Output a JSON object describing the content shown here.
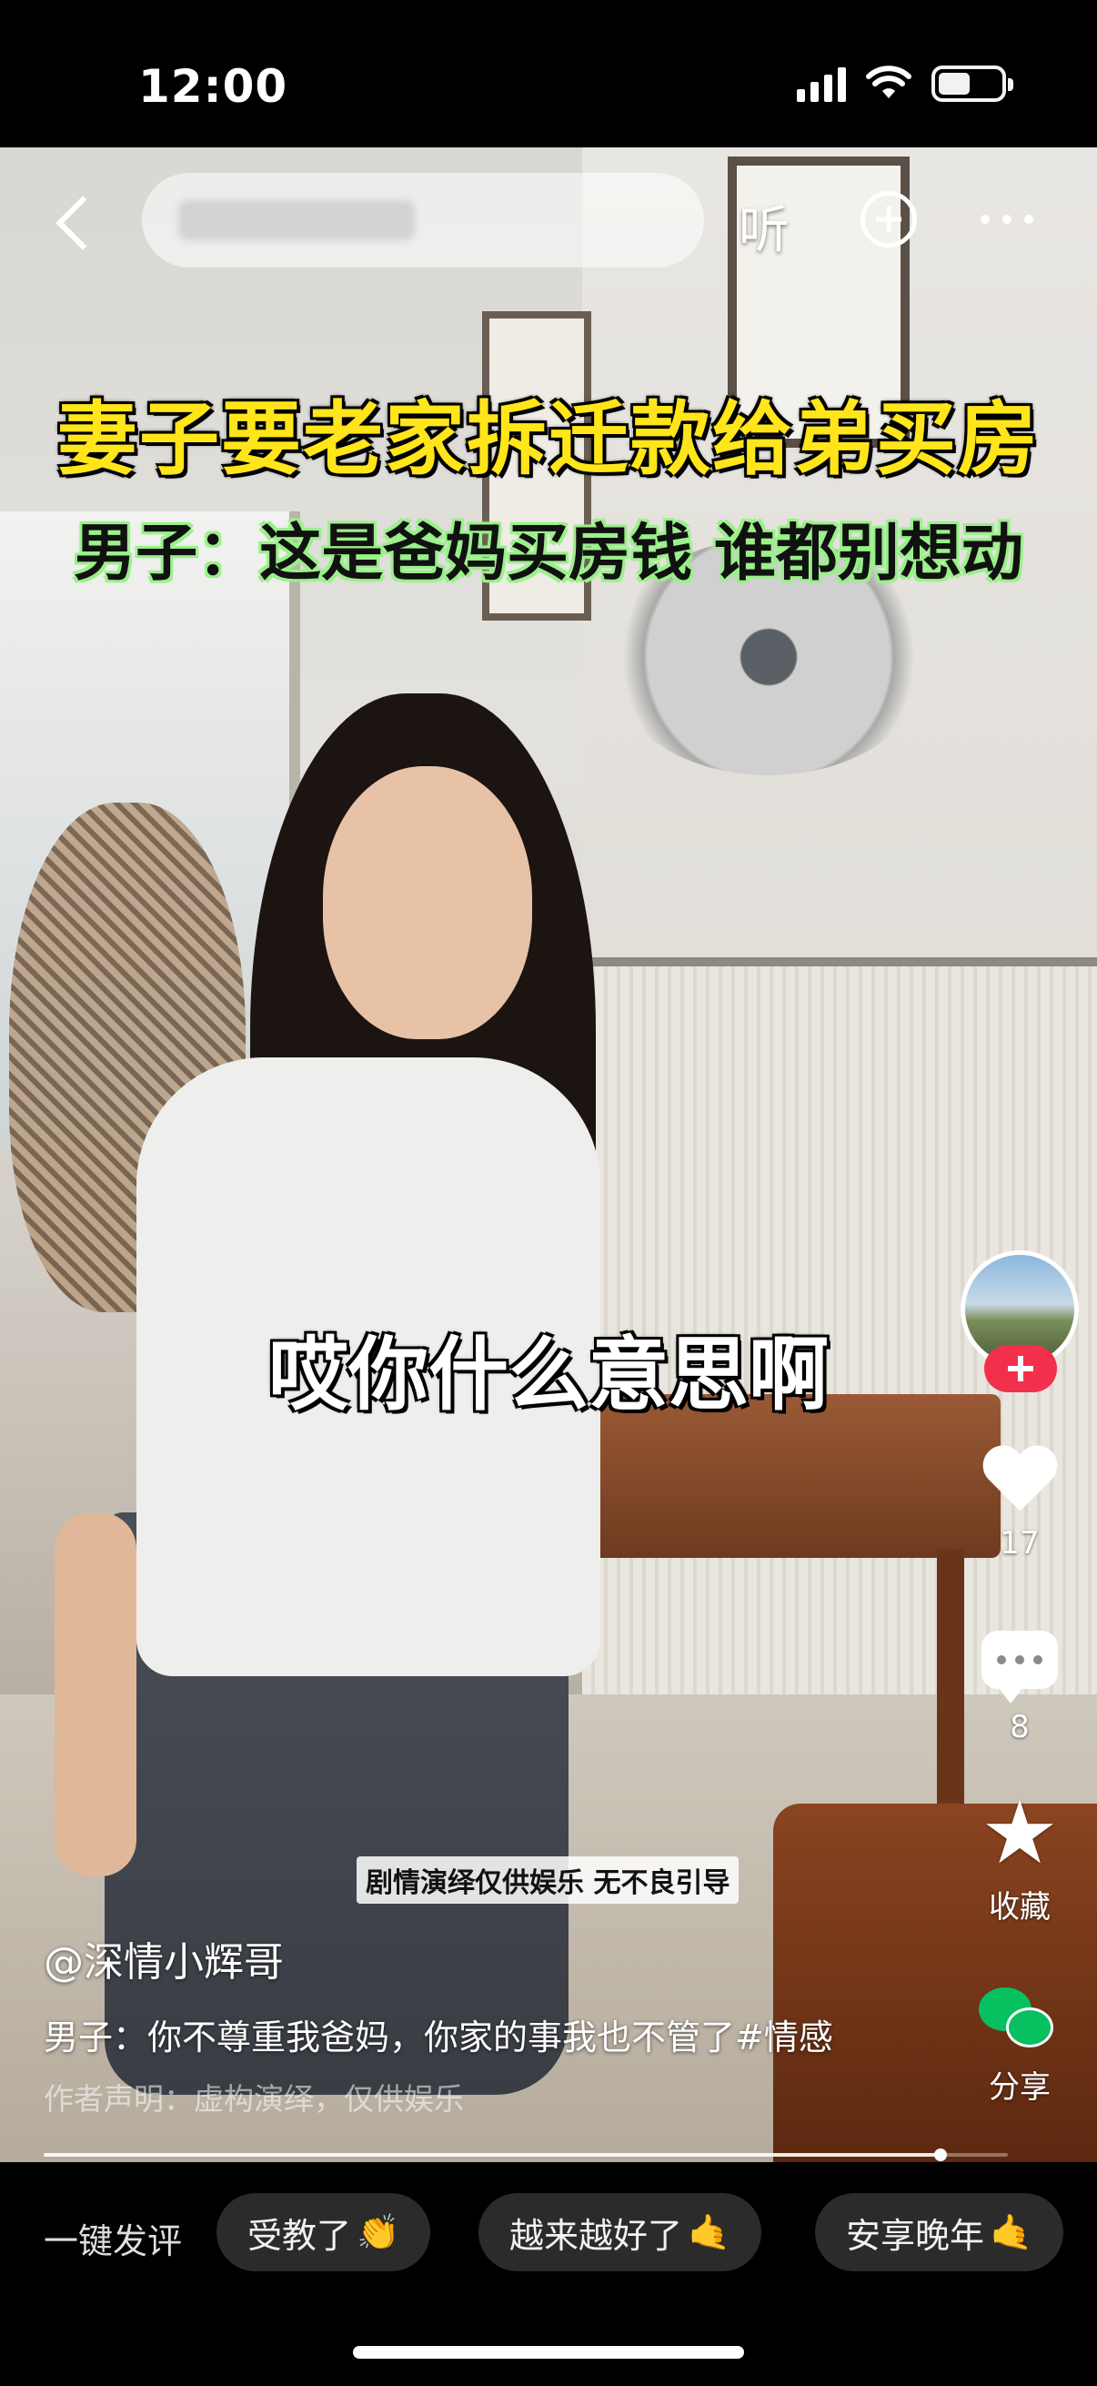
{
  "status_bar": {
    "time": "12:00"
  },
  "nav": {
    "listen_label": "听"
  },
  "overlay": {
    "headline": "妻子要老家拆迁款给弟买房",
    "subheadline": "男子：这是爸妈买房钱 谁都别想动",
    "subtitle": "哎你什么意思啊",
    "disclaimer_badge": "剧情演绎仅供娱乐 无不良引导"
  },
  "actions": {
    "like_count": "17",
    "comment_count": "8",
    "favorite_label": "收藏",
    "share_label": "分享"
  },
  "post": {
    "author": "@深情小辉哥",
    "caption": "男子：你不尊重我爸妈，你家的事我也不管了#情感",
    "author_declaration": "作者声明：虚构演绎，仅供娱乐",
    "progress": 0.93
  },
  "quick_reply": {
    "label": "一键发评",
    "chips": [
      {
        "text": "受教了",
        "emoji": "👏"
      },
      {
        "text": "越来越好了",
        "emoji": "🤙"
      },
      {
        "text": "安享晚年",
        "emoji": "🤙"
      }
    ]
  },
  "colors": {
    "headline": "#ffe51a",
    "subheadline_glow": "#9af08a",
    "follow": "#f2304b",
    "wechat": "#07c160"
  }
}
